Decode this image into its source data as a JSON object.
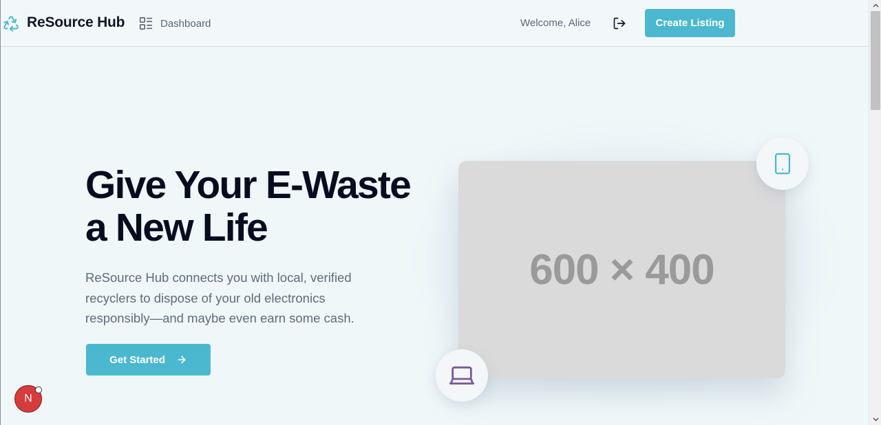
{
  "header": {
    "brand": "ReSource Hub",
    "logo_icon": "recycle-icon",
    "nav": {
      "dashboard_label": "Dashboard",
      "dashboard_icon": "dashboard-icon"
    },
    "welcome_text": "Welcome, Alice",
    "logout_icon": "logout-icon",
    "create_listing_label": "Create Listing"
  },
  "hero": {
    "title": "Give Your E-Waste a New Life",
    "description": "ReSource Hub connects you with local, verified recyclers to dispose of your old electronics responsibly—and maybe even earn some cash.",
    "cta_label": "Get Started",
    "cta_icon": "arrow-right-icon",
    "image_placeholder": "600 × 400",
    "badges": [
      {
        "icon": "smartphone-icon",
        "color": "#4bb8cf"
      },
      {
        "icon": "laptop-icon",
        "color": "#7a5a98"
      }
    ]
  },
  "dev_indicator": {
    "letter": "N"
  },
  "colors": {
    "accent": "#4bb8cf",
    "background": "#f0f7f9",
    "heading": "#070d1f",
    "body_text": "#5f6b7c",
    "laptop_accent": "#7a5a98"
  }
}
